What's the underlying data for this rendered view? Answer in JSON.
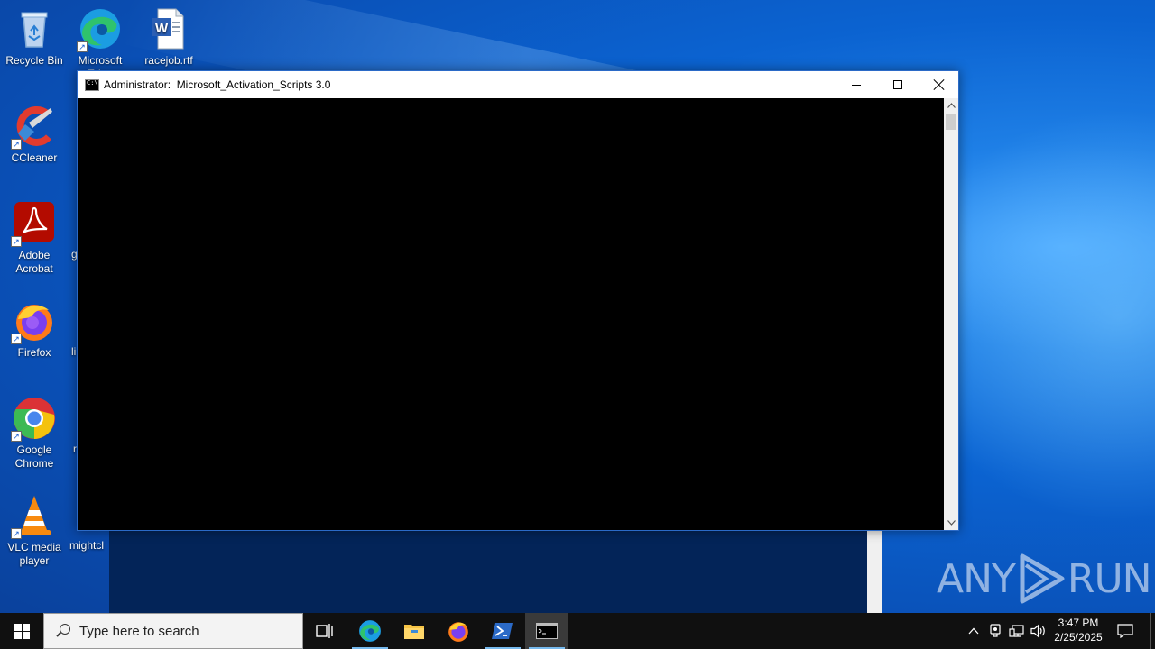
{
  "desktop": {
    "icons": [
      {
        "label": "Recycle Bin"
      },
      {
        "label": "Microsoft Edge"
      },
      {
        "label": "racejob.rtf"
      },
      {
        "label": "CCleaner"
      },
      {
        "label": "Adobe Acrobat"
      },
      {
        "label": "Firefox"
      },
      {
        "label": "Google Chrome"
      },
      {
        "label": "VLC media player"
      }
    ],
    "peek_labels": [
      "g",
      "li",
      "r",
      "mightcl"
    ]
  },
  "window": {
    "title": "Administrator:  Microsoft_Activation_Scripts 3.0",
    "console_text": ""
  },
  "watermark": {
    "left": "ANY",
    "right": "RUN"
  },
  "taskbar": {
    "search_placeholder": "Type here to search",
    "apps": [
      "task-view",
      "edge",
      "file-explorer",
      "firefox",
      "powershell",
      "cmd"
    ],
    "clock_time": "3:47 PM",
    "clock_date": "2/25/2025"
  },
  "colors": {
    "taskbar": "#101010",
    "accent": "#76b9ed",
    "console_bg": "#000000"
  }
}
